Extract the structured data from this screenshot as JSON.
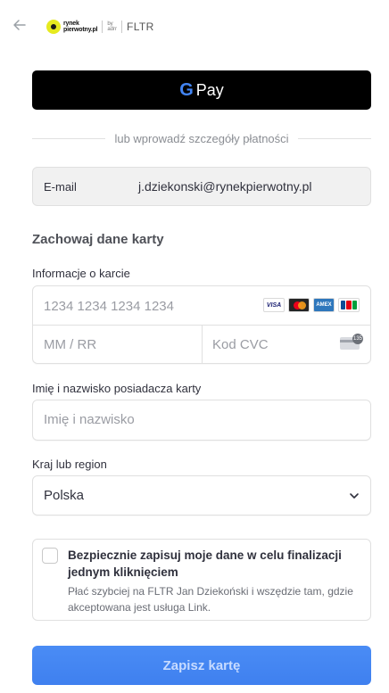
{
  "header": {
    "back_icon": "arrow-left-icon",
    "logo_line1": "rynek",
    "logo_line2": "pierwotny.pl",
    "logo_by_line1": "by",
    "logo_by_line2": "adrr",
    "brand": "FLTR"
  },
  "gpay": {
    "g": "G",
    "label": "Pay"
  },
  "divider_text": "lub wprowadź szczegóły płatności",
  "email": {
    "label": "E-mail",
    "value": "j.dziekonski@rynekpierwotny.pl"
  },
  "section_title": "Zachowaj dane karty",
  "card": {
    "label": "Informacje o karcie",
    "number_placeholder": "1234 1234 1234 1234",
    "expiry_placeholder": "MM / RR",
    "cvc_placeholder": "Kod CVC",
    "brands": [
      "VISA",
      "mastercard",
      "AMEX",
      "JCB"
    ],
    "cvc_badge": "135"
  },
  "name": {
    "label": "Imię i nazwisko posiadacza karty",
    "placeholder": "Imię i nazwisko"
  },
  "country": {
    "label": "Kraj lub region",
    "value": "Polska"
  },
  "link": {
    "title": "Bezpiecznie zapisuj moje dane w celu finalizacji jednym kliknięciem",
    "description": "Płać szybciej na FLTR Jan Dziekoński i wszędzie tam, gdzie akceptowana jest usługa Link."
  },
  "submit_label": "Zapisz kartę",
  "colors": {
    "accent": "#4285f4",
    "gpay_bg": "#000000",
    "logo_yellow": "#e6ea1f"
  }
}
